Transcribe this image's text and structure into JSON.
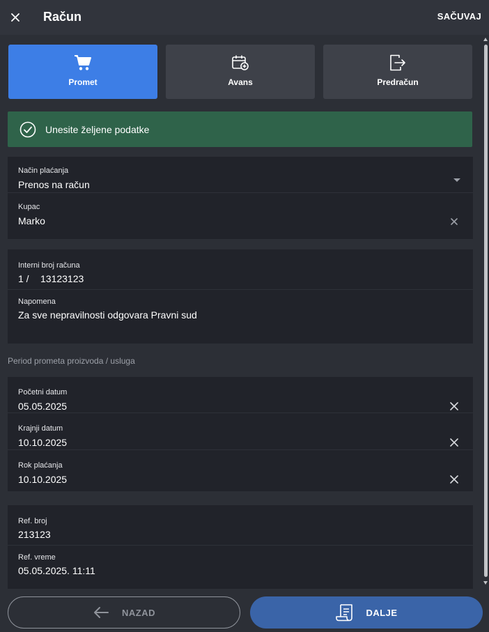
{
  "header": {
    "title": "Račun",
    "save_label": "SAČUVAJ",
    "close_icon": "close-icon"
  },
  "invoice_types": [
    {
      "label": "Promet",
      "icon": "cart-icon",
      "active": true
    },
    {
      "label": "Avans",
      "icon": "calendar-add-icon",
      "active": false
    },
    {
      "label": "Predračun",
      "icon": "document-export-icon",
      "active": false
    }
  ],
  "alert": {
    "text": "Unesite željene podatke",
    "icon": "check-circle-icon",
    "color": "#2f634a"
  },
  "payment": {
    "method_label": "Način plaćanja",
    "method_value": "Prenos na račun",
    "customer_label": "Kupac",
    "customer_value": "Marko"
  },
  "invoice": {
    "number_label": "Interni broj računa",
    "number_prefix": "1 /",
    "number_value": "13123123",
    "note_label": "Napomena",
    "note_value": "Za sve nepravilnosti odgovara Pravni sud"
  },
  "period": {
    "section_title": "Period prometa proizvoda / usluga",
    "start_label": "Početni datum",
    "start_value": "05.05.2025",
    "end_label": "Krajnji datum",
    "end_value": "10.10.2025",
    "due_label": "Rok plaćanja",
    "due_value": "10.10.2025"
  },
  "reference": {
    "number_label": "Ref. broj",
    "number_value": "213123",
    "time_label": "Ref. vreme",
    "time_value": "05.05.2025. 11:11"
  },
  "footer": {
    "back_label": "NAZAD",
    "next_label": "DALJE"
  },
  "colors": {
    "accent": "#3d7ee6",
    "next_button": "#3a64a8",
    "card": "#21232a",
    "background": "#2c2f36"
  }
}
